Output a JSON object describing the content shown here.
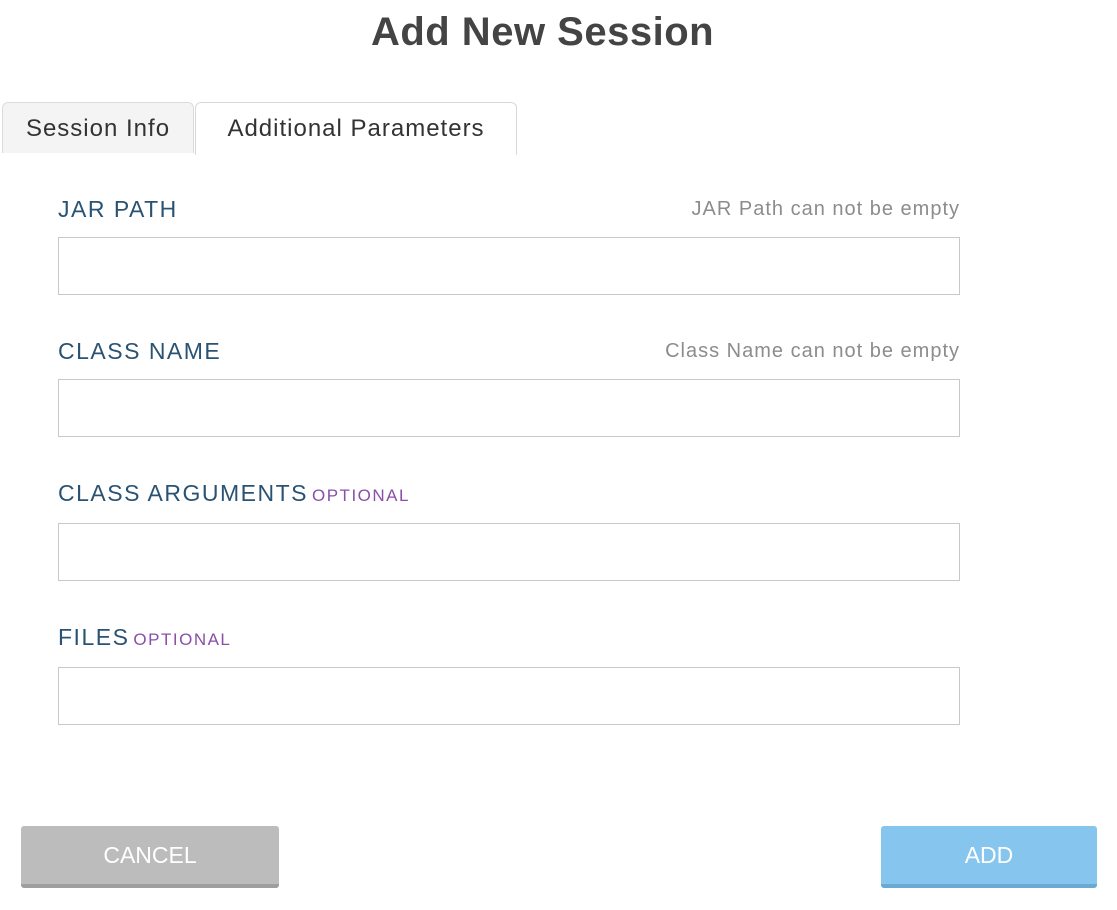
{
  "dialog": {
    "title": "Add New Session"
  },
  "tabs": [
    {
      "label": "Session Info",
      "active": false
    },
    {
      "label": "Additional Parameters",
      "active": true
    }
  ],
  "fields": {
    "jar_path": {
      "label": "JAR PATH",
      "error": "JAR Path can not be empty",
      "value": ""
    },
    "class_name": {
      "label": "CLASS NAME",
      "error": "Class Name can not be empty",
      "value": ""
    },
    "class_arguments": {
      "label": "CLASS ARGUMENTS",
      "optional": "OPTIONAL",
      "value": ""
    },
    "files": {
      "label": "FILES",
      "optional": "OPTIONAL",
      "value": ""
    }
  },
  "buttons": {
    "cancel": "CANCEL",
    "add": "ADD"
  },
  "colors": {
    "label": "#2a5373",
    "optional": "#8a4fa8",
    "error": "#8c8c8c",
    "cancel_bg": "#bcbcbc",
    "add_bg": "#85c5ee"
  }
}
